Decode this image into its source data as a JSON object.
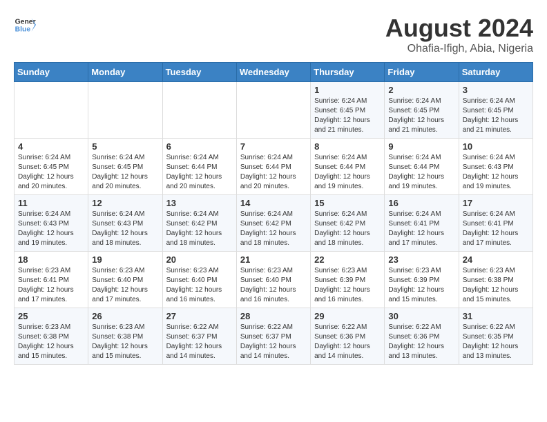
{
  "logo": {
    "line1": "General",
    "line2": "Blue"
  },
  "title": "August 2024",
  "subtitle": "Ohafia-Ifigh, Abia, Nigeria",
  "days_of_week": [
    "Sunday",
    "Monday",
    "Tuesday",
    "Wednesday",
    "Thursday",
    "Friday",
    "Saturday"
  ],
  "weeks": [
    [
      {
        "day": "",
        "info": ""
      },
      {
        "day": "",
        "info": ""
      },
      {
        "day": "",
        "info": ""
      },
      {
        "day": "",
        "info": ""
      },
      {
        "day": "1",
        "info": "Sunrise: 6:24 AM\nSunset: 6:45 PM\nDaylight: 12 hours\nand 21 minutes."
      },
      {
        "day": "2",
        "info": "Sunrise: 6:24 AM\nSunset: 6:45 PM\nDaylight: 12 hours\nand 21 minutes."
      },
      {
        "day": "3",
        "info": "Sunrise: 6:24 AM\nSunset: 6:45 PM\nDaylight: 12 hours\nand 21 minutes."
      }
    ],
    [
      {
        "day": "4",
        "info": "Sunrise: 6:24 AM\nSunset: 6:45 PM\nDaylight: 12 hours\nand 20 minutes."
      },
      {
        "day": "5",
        "info": "Sunrise: 6:24 AM\nSunset: 6:45 PM\nDaylight: 12 hours\nand 20 minutes."
      },
      {
        "day": "6",
        "info": "Sunrise: 6:24 AM\nSunset: 6:44 PM\nDaylight: 12 hours\nand 20 minutes."
      },
      {
        "day": "7",
        "info": "Sunrise: 6:24 AM\nSunset: 6:44 PM\nDaylight: 12 hours\nand 20 minutes."
      },
      {
        "day": "8",
        "info": "Sunrise: 6:24 AM\nSunset: 6:44 PM\nDaylight: 12 hours\nand 19 minutes."
      },
      {
        "day": "9",
        "info": "Sunrise: 6:24 AM\nSunset: 6:44 PM\nDaylight: 12 hours\nand 19 minutes."
      },
      {
        "day": "10",
        "info": "Sunrise: 6:24 AM\nSunset: 6:43 PM\nDaylight: 12 hours\nand 19 minutes."
      }
    ],
    [
      {
        "day": "11",
        "info": "Sunrise: 6:24 AM\nSunset: 6:43 PM\nDaylight: 12 hours\nand 19 minutes."
      },
      {
        "day": "12",
        "info": "Sunrise: 6:24 AM\nSunset: 6:43 PM\nDaylight: 12 hours\nand 18 minutes."
      },
      {
        "day": "13",
        "info": "Sunrise: 6:24 AM\nSunset: 6:42 PM\nDaylight: 12 hours\nand 18 minutes."
      },
      {
        "day": "14",
        "info": "Sunrise: 6:24 AM\nSunset: 6:42 PM\nDaylight: 12 hours\nand 18 minutes."
      },
      {
        "day": "15",
        "info": "Sunrise: 6:24 AM\nSunset: 6:42 PM\nDaylight: 12 hours\nand 18 minutes."
      },
      {
        "day": "16",
        "info": "Sunrise: 6:24 AM\nSunset: 6:41 PM\nDaylight: 12 hours\nand 17 minutes."
      },
      {
        "day": "17",
        "info": "Sunrise: 6:24 AM\nSunset: 6:41 PM\nDaylight: 12 hours\nand 17 minutes."
      }
    ],
    [
      {
        "day": "18",
        "info": "Sunrise: 6:23 AM\nSunset: 6:41 PM\nDaylight: 12 hours\nand 17 minutes."
      },
      {
        "day": "19",
        "info": "Sunrise: 6:23 AM\nSunset: 6:40 PM\nDaylight: 12 hours\nand 17 minutes."
      },
      {
        "day": "20",
        "info": "Sunrise: 6:23 AM\nSunset: 6:40 PM\nDaylight: 12 hours\nand 16 minutes."
      },
      {
        "day": "21",
        "info": "Sunrise: 6:23 AM\nSunset: 6:40 PM\nDaylight: 12 hours\nand 16 minutes."
      },
      {
        "day": "22",
        "info": "Sunrise: 6:23 AM\nSunset: 6:39 PM\nDaylight: 12 hours\nand 16 minutes."
      },
      {
        "day": "23",
        "info": "Sunrise: 6:23 AM\nSunset: 6:39 PM\nDaylight: 12 hours\nand 15 minutes."
      },
      {
        "day": "24",
        "info": "Sunrise: 6:23 AM\nSunset: 6:38 PM\nDaylight: 12 hours\nand 15 minutes."
      }
    ],
    [
      {
        "day": "25",
        "info": "Sunrise: 6:23 AM\nSunset: 6:38 PM\nDaylight: 12 hours\nand 15 minutes."
      },
      {
        "day": "26",
        "info": "Sunrise: 6:23 AM\nSunset: 6:38 PM\nDaylight: 12 hours\nand 15 minutes."
      },
      {
        "day": "27",
        "info": "Sunrise: 6:22 AM\nSunset: 6:37 PM\nDaylight: 12 hours\nand 14 minutes."
      },
      {
        "day": "28",
        "info": "Sunrise: 6:22 AM\nSunset: 6:37 PM\nDaylight: 12 hours\nand 14 minutes."
      },
      {
        "day": "29",
        "info": "Sunrise: 6:22 AM\nSunset: 6:36 PM\nDaylight: 12 hours\nand 14 minutes."
      },
      {
        "day": "30",
        "info": "Sunrise: 6:22 AM\nSunset: 6:36 PM\nDaylight: 12 hours\nand 13 minutes."
      },
      {
        "day": "31",
        "info": "Sunrise: 6:22 AM\nSunset: 6:35 PM\nDaylight: 12 hours\nand 13 minutes."
      }
    ]
  ]
}
